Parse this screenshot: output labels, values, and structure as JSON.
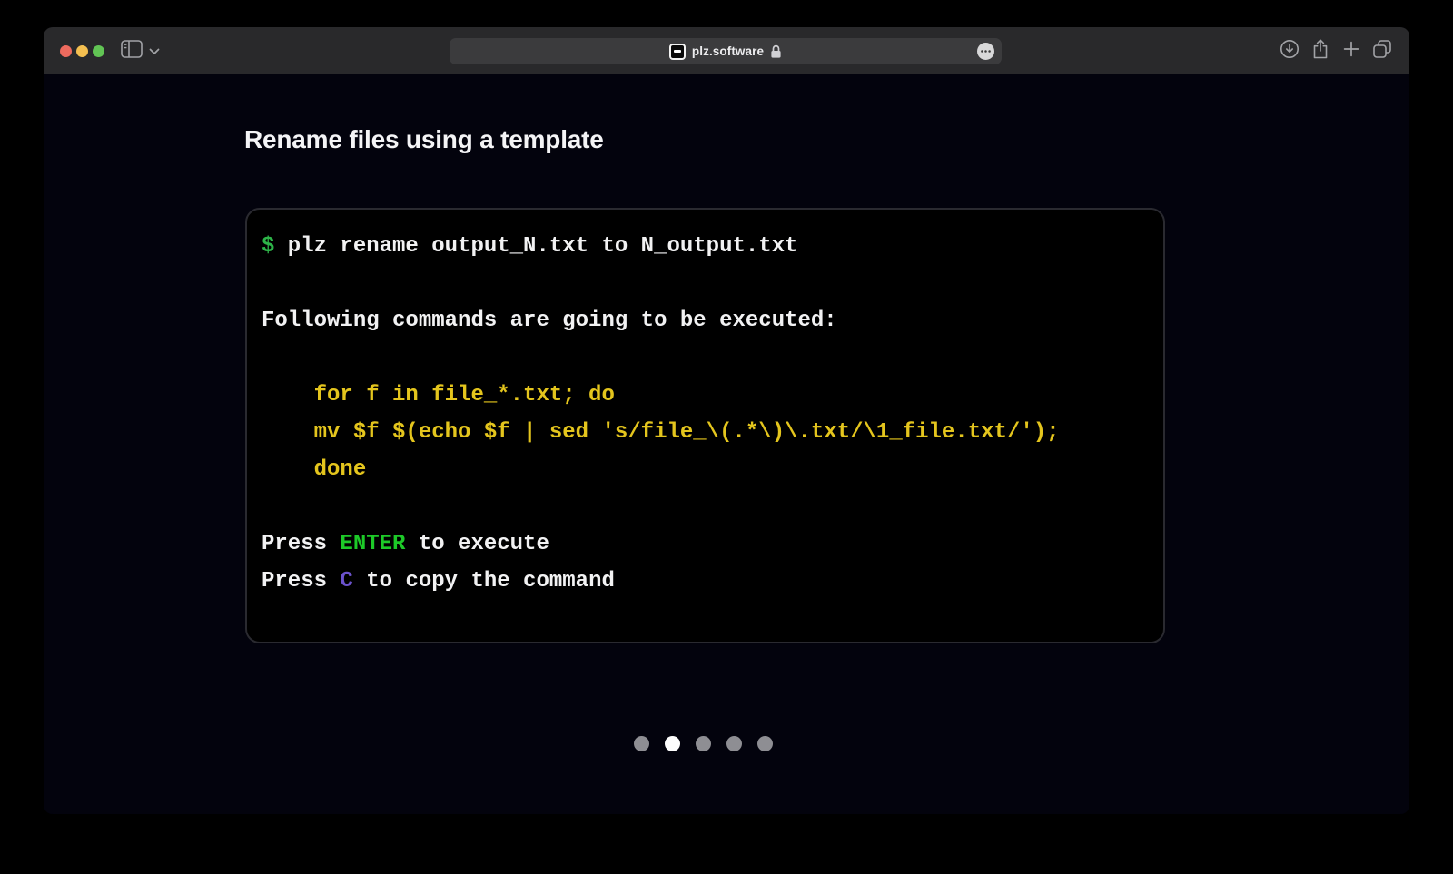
{
  "browser": {
    "address_bar": {
      "site": "plz.software"
    },
    "icons": {
      "toolbar_left": [
        "sidebar-icon",
        "chevron-down-icon"
      ],
      "address_bar": [
        "terminal-favicon-icon",
        "lock-icon",
        "ellipsis-icon"
      ],
      "toolbar_right": [
        "download-icon",
        "share-icon",
        "plus-icon",
        "tab-overview-icon"
      ]
    },
    "traffic_light_colors": {
      "close": "#ed6a5e",
      "minimize": "#f4bf50",
      "zoom": "#61c454"
    }
  },
  "page": {
    "heading": "Rename files using a template",
    "terminal": {
      "prompt": "$",
      "command": " plz rename output_N.txt to N_output.txt",
      "message": "Following commands are going to be executed:",
      "code": [
        "    for f in file_*.txt; do",
        "    mv $f $(echo $f | sed 's/file_\\(.*\\)\\.txt/\\1_file.txt/');",
        "    done"
      ],
      "hint_enter": {
        "prefix": "Press ",
        "key": "ENTER",
        "suffix": " to execute"
      },
      "hint_copy": {
        "prefix": "Press ",
        "key": "C",
        "suffix": " to copy the command"
      }
    },
    "carousel": {
      "total_dots": 5,
      "active_dot": 2
    }
  },
  "colors": {
    "page_bg": "#03030d",
    "toolbar_bg": "#29292b",
    "terminal_bg": "#000000",
    "terminal_border": "#2a2a30",
    "prompt_green": "#2db448",
    "enter_green": "#1dc928",
    "code_yellow": "#e4c51d",
    "copy_purple": "#6b52cc",
    "terminal_text": "#f2f2f3"
  }
}
